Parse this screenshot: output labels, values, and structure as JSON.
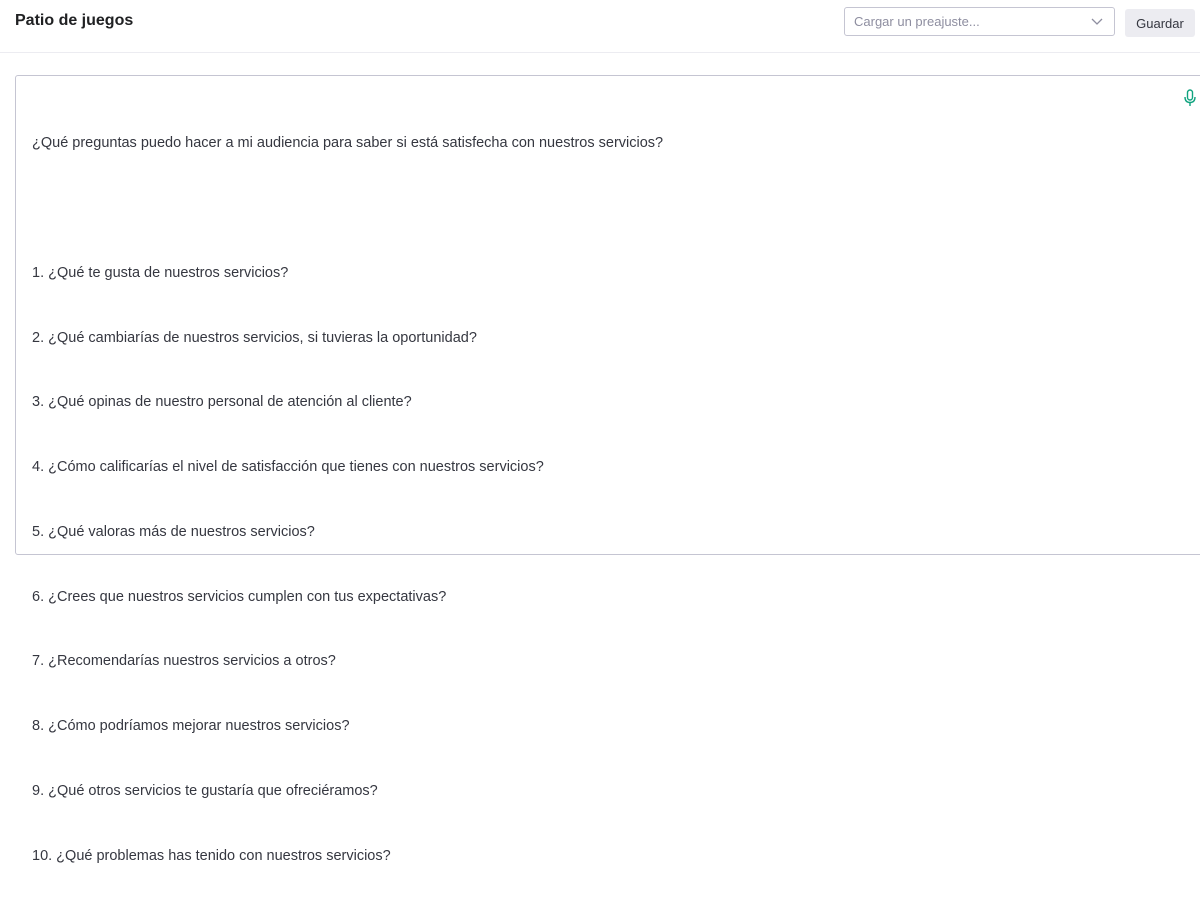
{
  "header": {
    "title": "Patio de juegos",
    "preset_placeholder": "Cargar un preajuste...",
    "save_label": "Guardar"
  },
  "editor": {
    "lines": [
      "¿Qué preguntas puedo hacer a mi audiencia para saber si está satisfecha con nuestros servicios?",
      "",
      "1. ¿Qué te gusta de nuestros servicios?",
      "2. ¿Qué cambiarías de nuestros servicios, si tuvieras la oportunidad?",
      "3. ¿Qué opinas de nuestro personal de atención al cliente?",
      "4. ¿Cómo calificarías el nivel de satisfacción que tienes con nuestros servicios?",
      "5. ¿Qué valoras más de nuestros servicios?",
      "6. ¿Crees que nuestros servicios cumplen con tus expectativas?",
      "7. ¿Recomendarías nuestros servicios a otros?",
      "8. ¿Cómo podríamos mejorar nuestros servicios?",
      "9. ¿Qué otros servicios te gustaría que ofreciéramos?",
      "10. ¿Qué problemas has tenido con nuestros servicios?"
    ]
  },
  "icons": {
    "mic": "microphone-icon",
    "chevron": "chevron-down-icon"
  },
  "colors": {
    "mic_accent": "#10a37f",
    "button_bg": "#ececf1",
    "border": "#c5c5d2"
  }
}
